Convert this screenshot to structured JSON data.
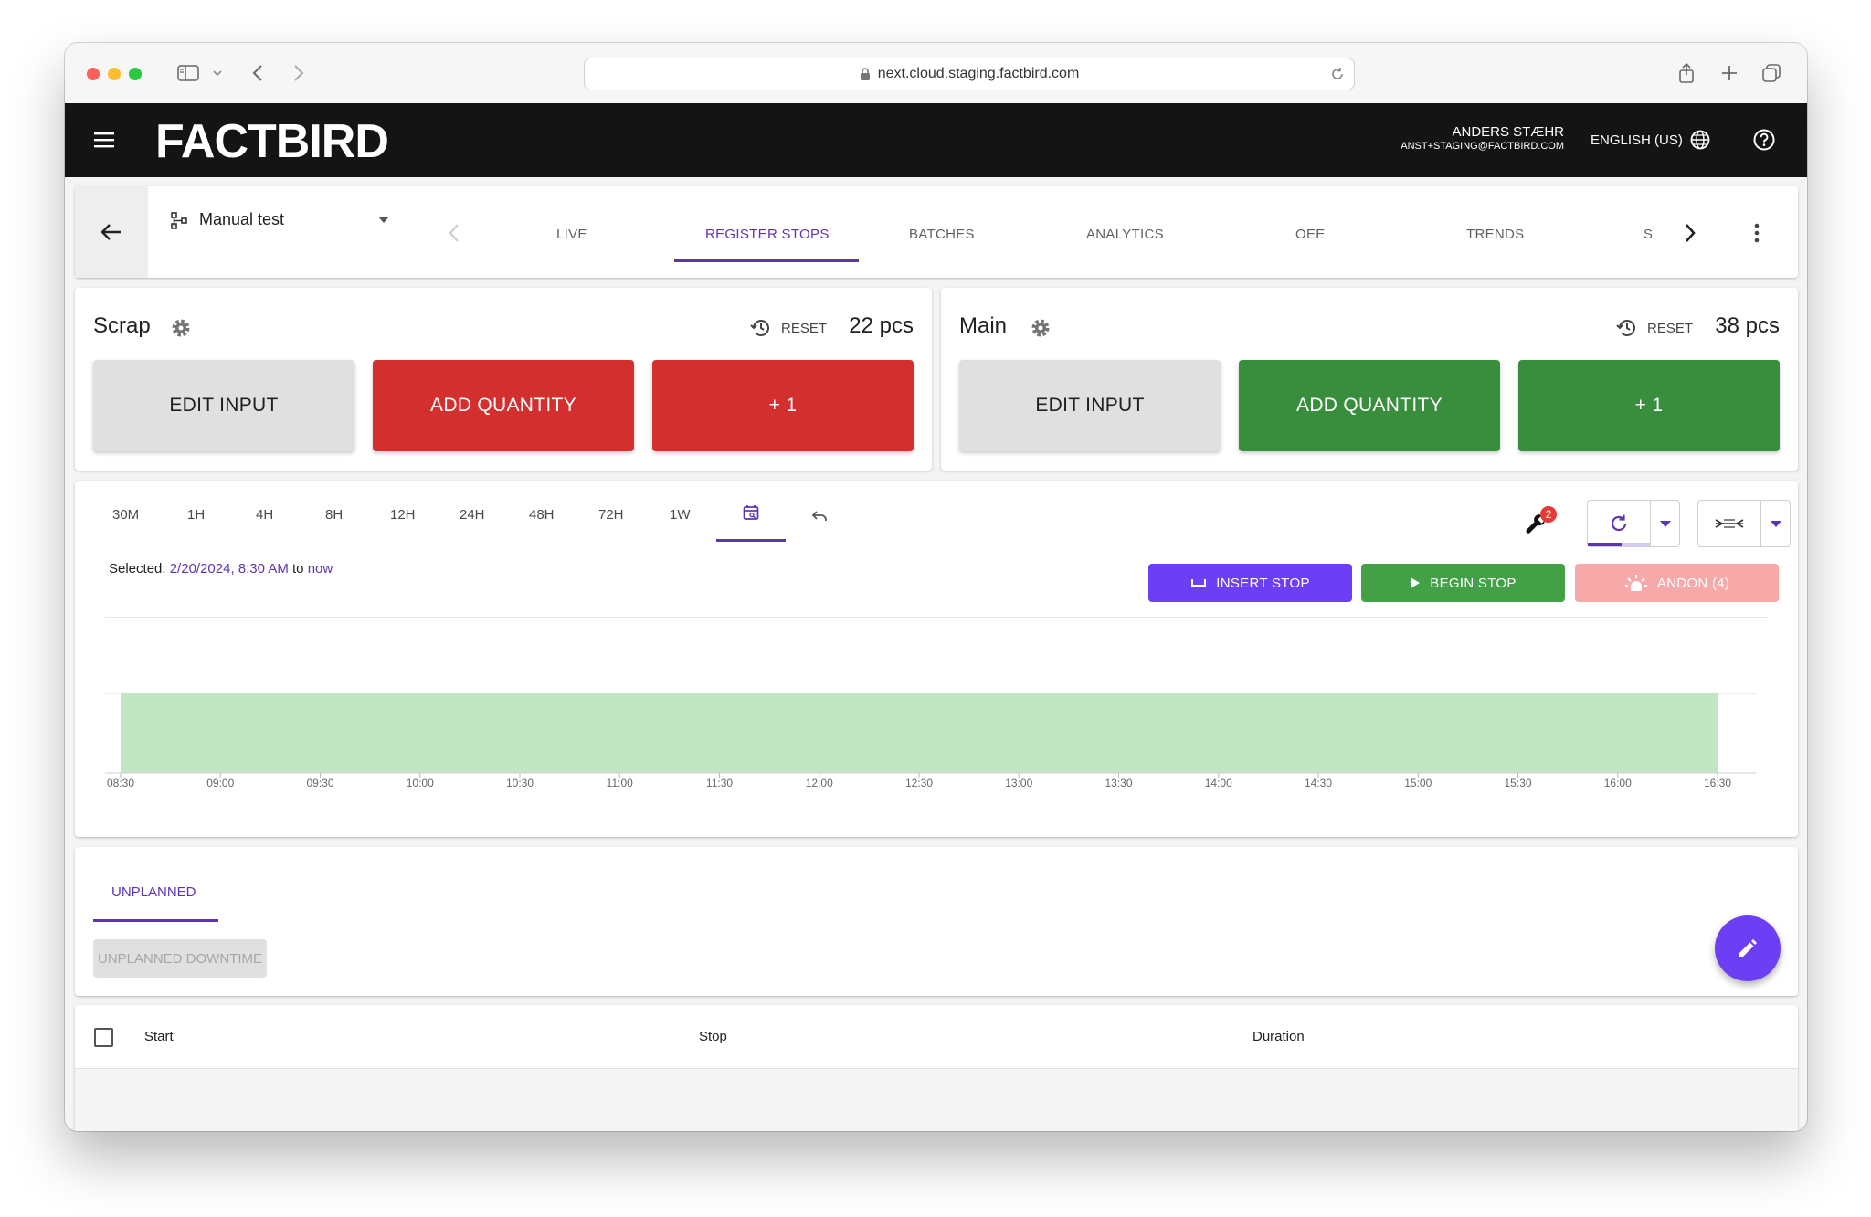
{
  "browser": {
    "url": "next.cloud.staging.factbird.com"
  },
  "app": {
    "logo": "FACTBIRD",
    "user_name": "ANDERS STÆHR",
    "user_email": "ANST+STAGING@FACTBIRD.COM",
    "language": "ENGLISH (US)"
  },
  "line_selector": {
    "label": "Manual test"
  },
  "tabs": [
    {
      "label": "LIVE"
    },
    {
      "label": "REGISTER STOPS"
    },
    {
      "label": "BATCHES"
    },
    {
      "label": "ANALYTICS"
    },
    {
      "label": "OEE"
    },
    {
      "label": "TRENDS"
    },
    {
      "label": "S"
    }
  ],
  "counters": [
    {
      "title": "Scrap",
      "reset_label": "RESET",
      "count": "22 pcs",
      "edit_label": "EDIT INPUT",
      "add_label": "ADD QUANTITY",
      "plus_label": "+ 1",
      "color": "#d32f2f"
    },
    {
      "title": "Main",
      "reset_label": "RESET",
      "count": "38 pcs",
      "edit_label": "EDIT INPUT",
      "add_label": "ADD QUANTITY",
      "plus_label": "+ 1",
      "color": "#388e3c"
    }
  ],
  "timeline": {
    "ranges": [
      "30M",
      "1H",
      "4H",
      "8H",
      "12H",
      "24H",
      "48H",
      "72H",
      "1W"
    ],
    "selected_prefix": "Selected:",
    "selected_start": "2/20/2024, 8:30 AM",
    "selected_to": "to",
    "selected_end": "now",
    "wrench_badge": "2",
    "insert_stop_label": "INSERT STOP",
    "begin_stop_label": "BEGIN STOP",
    "andon_label": "ANDON (4)",
    "insert_color": "#6c3ef4",
    "begin_color": "#43a047",
    "andon_color": "#f7a8a8"
  },
  "chart_data": {
    "type": "area",
    "x_ticks": [
      "08:30",
      "09:00",
      "09:30",
      "10:00",
      "10:30",
      "11:00",
      "11:30",
      "12:00",
      "12:30",
      "13:00",
      "13:30",
      "14:00",
      "14:30",
      "15:00",
      "15:30",
      "16:00",
      "16:30"
    ],
    "series": [
      {
        "start": "08:30",
        "end": "16:30",
        "color": "#c2e6c2"
      }
    ],
    "grid": false
  },
  "stops_section": {
    "tab_label": "UNPLANNED",
    "chip_label": "UNPLANNED DOWNTIME"
  },
  "table": {
    "columns": [
      "Start",
      "Stop",
      "Duration"
    ],
    "rows": []
  },
  "accent_color": "#5e35b1"
}
